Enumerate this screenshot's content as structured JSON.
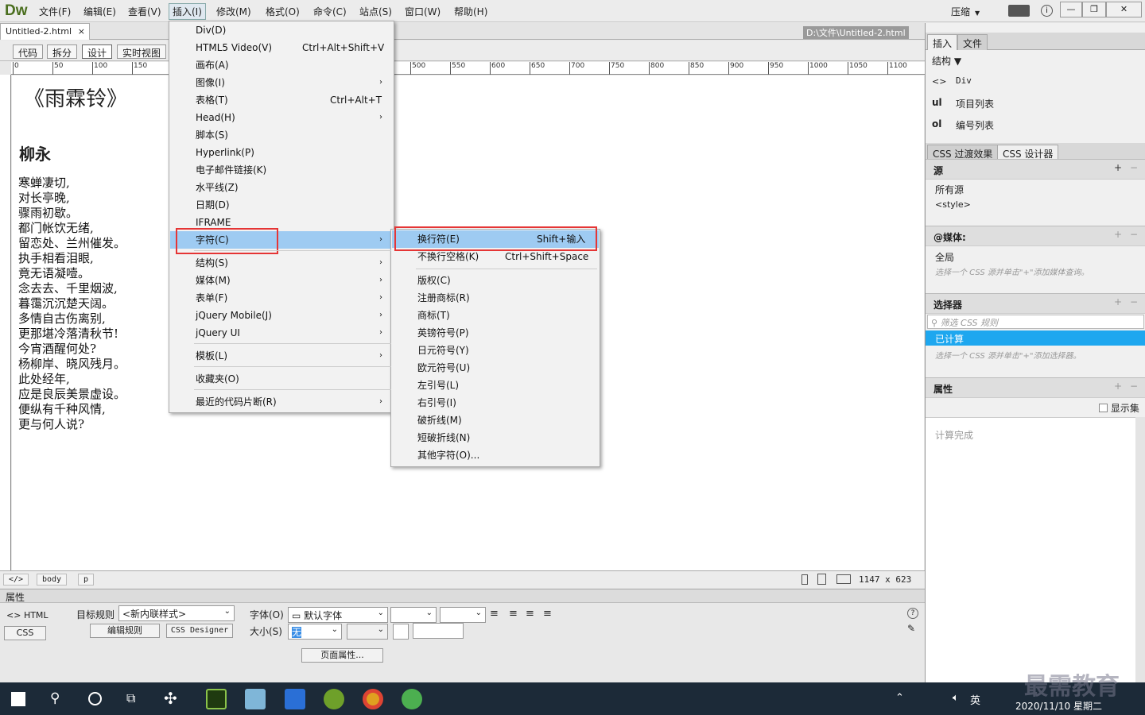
{
  "app": {
    "logo": "Dw",
    "menus": [
      "文件(F)",
      "编辑(E)",
      "查看(V)",
      "插入(I)",
      "修改(M)",
      "格式(O)",
      "命令(C)",
      "站点(S)",
      "窗口(W)",
      "帮助(H)"
    ],
    "compress": "压缩",
    "window_buttons": {
      "min": "—",
      "restore": "❐",
      "close": "✕"
    }
  },
  "document": {
    "tab_name": "Untitled-2.html",
    "tab_close": "×",
    "path": "D:\\文件\\Untitled-2.html",
    "view_buttons": [
      "代码",
      "拆分",
      "设计",
      "实时视图"
    ],
    "ruler_labels": [
      "0",
      "50",
      "100",
      "150",
      "500",
      "550",
      "600",
      "650",
      "700",
      "750",
      "800",
      "850",
      "900",
      "950",
      "1000",
      "1050",
      "1100"
    ],
    "poem_title": "《雨霖铃》",
    "poem_author": "柳永",
    "poem_lines": [
      "寒蝉凄切,",
      "对长亭晚,",
      "骤雨初歇。",
      "都门帐饮无绪,",
      "留恋处、兰州催发。",
      "执手相看泪眼,",
      "竟无语凝噎。",
      "念去去、千里烟波,",
      "暮霭沉沉楚天阔。",
      "多情自古伤离别,",
      "更那堪冷落清秋节!",
      "今宵酒醒何处?",
      "杨柳岸、晓风残月。",
      "此处经年,",
      "应是良辰美景虚设。",
      "便纵有千种风情,",
      "更与何人说?"
    ]
  },
  "status": {
    "tag_root": "</>",
    "tags": [
      "body",
      "p"
    ],
    "size": "1147 x 623"
  },
  "insert_menu": {
    "items": [
      {
        "label": "Div(D)",
        "shortcut": ""
      },
      {
        "label": "HTML5 Video(V)",
        "shortcut": "Ctrl+Alt+Shift+V"
      },
      {
        "label": "画布(A)",
        "shortcut": ""
      },
      {
        "label": "图像(I)",
        "shortcut": "",
        "sub": true
      },
      {
        "label": "表格(T)",
        "shortcut": "Ctrl+Alt+T"
      },
      {
        "label": "Head(H)",
        "shortcut": "",
        "sub": true
      },
      {
        "label": "脚本(S)",
        "shortcut": ""
      },
      {
        "label": "Hyperlink(P)",
        "shortcut": ""
      },
      {
        "label": "电子邮件链接(K)",
        "shortcut": ""
      },
      {
        "label": "水平线(Z)",
        "shortcut": ""
      },
      {
        "label": "日期(D)",
        "shortcut": ""
      },
      {
        "label": "IFRAME",
        "shortcut": ""
      },
      {
        "label": "字符(C)",
        "shortcut": "",
        "sub": true
      },
      {
        "label": "结构(S)",
        "shortcut": "",
        "sub": true
      },
      {
        "label": "媒体(M)",
        "shortcut": "",
        "sub": true
      },
      {
        "label": "表单(F)",
        "shortcut": "",
        "sub": true
      },
      {
        "label": "jQuery Mobile(J)",
        "shortcut": "",
        "sub": true
      },
      {
        "label": "jQuery UI",
        "shortcut": "",
        "sub": true
      },
      {
        "label": "模板(L)",
        "shortcut": "",
        "sub": true
      },
      {
        "label": "收藏夹(O)",
        "shortcut": ""
      },
      {
        "label": "最近的代码片断(R)",
        "shortcut": "",
        "sub": true
      }
    ]
  },
  "char_menu": {
    "items": [
      {
        "label": "换行符(E)",
        "shortcut": "Shift+输入"
      },
      {
        "label": "不换行空格(K)",
        "shortcut": "Ctrl+Shift+Space"
      },
      {
        "label": "版权(C)",
        "shortcut": ""
      },
      {
        "label": "注册商标(R)",
        "shortcut": ""
      },
      {
        "label": "商标(T)",
        "shortcut": ""
      },
      {
        "label": "英镑符号(P)",
        "shortcut": ""
      },
      {
        "label": "日元符号(Y)",
        "shortcut": ""
      },
      {
        "label": "欧元符号(U)",
        "shortcut": ""
      },
      {
        "label": "左引号(L)",
        "shortcut": ""
      },
      {
        "label": "右引号(I)",
        "shortcut": ""
      },
      {
        "label": "破折线(M)",
        "shortcut": ""
      },
      {
        "label": "短破折线(N)",
        "shortcut": ""
      },
      {
        "label": "其他字符(O)...",
        "shortcut": ""
      }
    ]
  },
  "properties": {
    "title": "属性",
    "html_btn": "HTML",
    "css_btn": "CSS",
    "target_rule_label": "目标规则",
    "target_rule_value": "<新内联样式>",
    "edit_rule": "编辑规则",
    "css_designer": "CSS Designer",
    "font_label": "字体(O)",
    "font_value": "默认字体",
    "size_label": "大小(S)",
    "size_value": "无",
    "page_props": "页面属性..."
  },
  "right_panel": {
    "tabs_top": [
      "插入",
      "文件"
    ],
    "structure_label": "结构",
    "insert_items": [
      {
        "icon": "<>",
        "label": "Div"
      },
      {
        "icon": "ul",
        "label": "项目列表"
      },
      {
        "icon": "ol",
        "label": "编号列表"
      }
    ],
    "tabs_css": [
      "CSS 过渡效果",
      "CSS 设计器"
    ],
    "sources_title": "源",
    "sources": [
      "所有源",
      "<style>"
    ],
    "media_title": "@媒体:",
    "media_global": "全局",
    "media_hint": "选择一个 CSS 源并单击\"+\"添加媒体查询。",
    "selector_title": "选择器",
    "selector_filter": "筛选 CSS 规则",
    "selector_computed": "已计算",
    "selector_hint": "选择一个 CSS 源并单击\"+\"添加选择器。",
    "properties_title": "属性",
    "show_set": "显示集",
    "computed_done": "计算完成"
  },
  "taskbar": {
    "ime": "英",
    "date": "2020/11/10 星期二",
    "watermark": "最需教育"
  }
}
